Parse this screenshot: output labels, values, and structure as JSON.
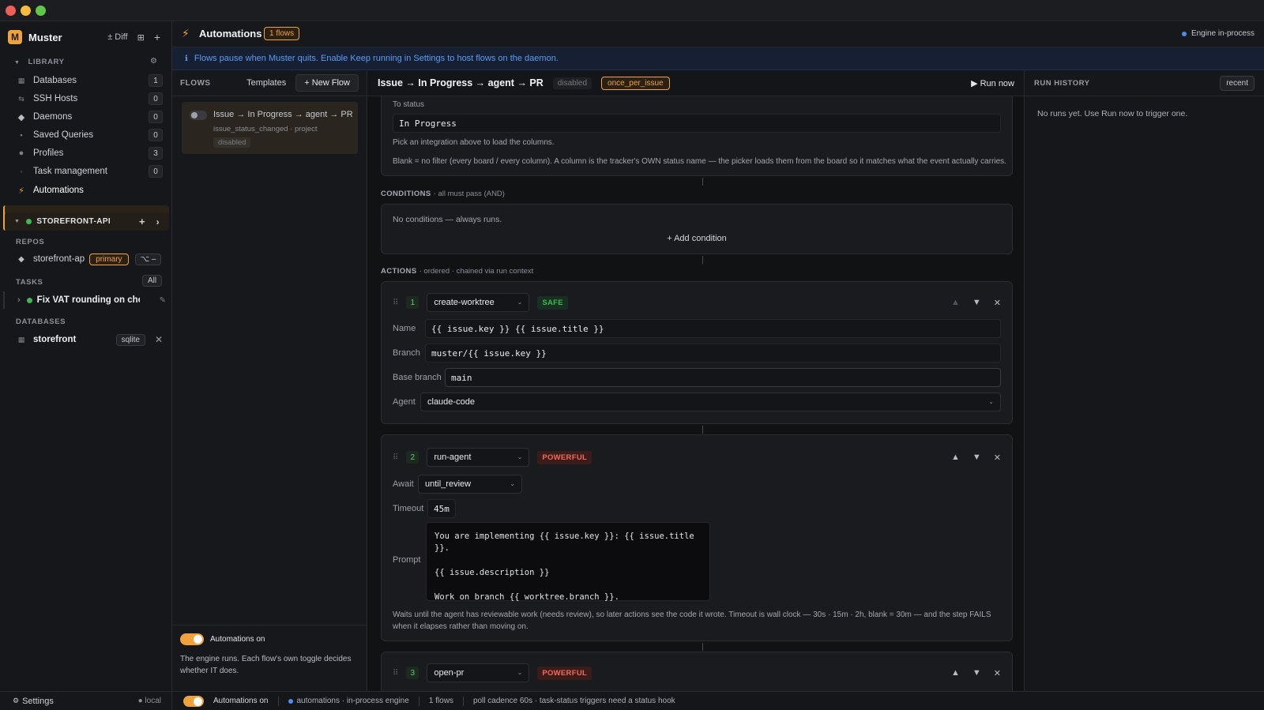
{
  "app": {
    "name": "Muster",
    "logo_letter": "M",
    "accent": "#f0a23b",
    "diff_label": "± Diff"
  },
  "sidebar": {
    "library_label": "LIBRARY",
    "items": [
      {
        "label": "Databases",
        "count": "1",
        "icon": "database-icon"
      },
      {
        "label": "SSH Hosts",
        "count": "0",
        "icon": "ssh-icon"
      },
      {
        "label": "Daemons",
        "count": "0",
        "icon": "daemon-icon"
      },
      {
        "label": "Saved Queries",
        "count": "0",
        "icon": "query-icon"
      },
      {
        "label": "Profiles",
        "count": "3",
        "icon": "profile-icon"
      },
      {
        "label": "Task management",
        "count": "0",
        "icon": "task-icon"
      },
      {
        "label": "Automations",
        "count": "",
        "icon": "bolt-icon"
      }
    ],
    "project_name": "STOREFRONT-API",
    "repos_label": "REPOS",
    "repo_name": "storefront-ap",
    "repo_badge": "primary",
    "repo_action": "⌥ –",
    "tasks_label": "TASKS",
    "tasks_filter": "All",
    "task_name": "Fix VAT rounding on check",
    "databases_label": "DATABASES",
    "db_name": "storefront",
    "db_type": "sqlite",
    "settings_label": "Settings",
    "local_label": "local"
  },
  "header": {
    "title": "Automations",
    "flows_badge": "1 flows",
    "engine_label": "Engine in-process",
    "engine_color": "#4d8df0"
  },
  "banner": {
    "text": "Flows pause when Muster quits. Enable Keep running in Settings to host flows on the daemon."
  },
  "flows": {
    "label": "FLOWS",
    "templates_label": "Templates",
    "new_flow_label": "+ New Flow",
    "card_title": "Issue → In Progress → agent → PR",
    "card_sub": "issue_status_changed · project",
    "card_status": "disabled",
    "footer_toggle_label": "Automations on",
    "footer_note": "The engine runs. Each flow's own toggle decides whether IT does."
  },
  "editor": {
    "title": "Issue → In Progress → agent → PR",
    "status": "disabled",
    "mode": "once_per_issue",
    "run_now": "▶ Run now",
    "trigger": {
      "to_status_label": "To status",
      "to_status_value": "In Progress",
      "hint1": "Pick an integration above to load the columns.",
      "hint2": "Blank = no filter (every board / every column). A column is the tracker's OWN status name — the picker loads them from the board so it matches what the event actually carries."
    },
    "conditions": {
      "label": "CONDITIONS",
      "sub": "· all must pass (AND)",
      "empty": "No conditions — always runs.",
      "add": "+ Add condition"
    },
    "actions": {
      "label": "ACTIONS",
      "sub": "· ordered · chained via run context",
      "steps": [
        {
          "num": "1",
          "type": "create-worktree",
          "badge": "SAFE",
          "name_label": "Name",
          "name_value": "{{ issue.key }} {{ issue.title }}",
          "branch_label": "Branch",
          "branch_value": "muster/{{ issue.key }}",
          "base_label": "Base branch",
          "base_value": "main",
          "agent_label": "Agent",
          "agent_value": "claude-code"
        },
        {
          "num": "2",
          "type": "run-agent",
          "badge": "POWERFUL",
          "await_label": "Await",
          "await_value": "until_review",
          "timeout_label": "Timeout",
          "timeout_value": "45m",
          "prompt_label": "Prompt",
          "prompt_lines": [
            "You are implementing {{ issue.key }}: {{ issue.title }}.",
            "{{ issue.description }}",
            "Work on branch {{ worktree.branch }}."
          ],
          "note": "Waits until the agent has reviewable work (needs review), so later actions see the code it wrote. Timeout is wall clock — 30s · 15m · 2h, blank = 30m — and the step FAILS when it elapses rather than moving on."
        },
        {
          "num": "3",
          "type": "open-pr",
          "badge": "POWERFUL"
        }
      ]
    }
  },
  "history": {
    "label": "RUN HISTORY",
    "filter": "recent",
    "empty": "No runs yet. Use Run now to trigger one."
  },
  "statusbar": {
    "toggle_label": "Automations on",
    "engine": "automations · in-process engine",
    "flows": "1 flows",
    "poll": "poll cadence 60s · task-status triggers need a status hook"
  }
}
